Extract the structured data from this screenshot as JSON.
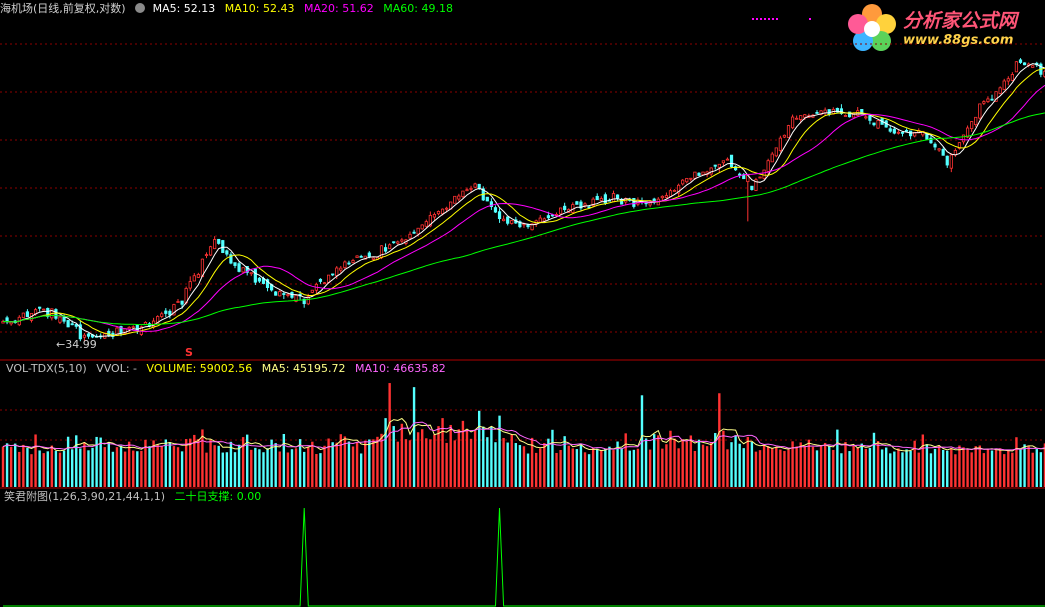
{
  "main_header": {
    "title": "海机场(日线,前复权,对数)",
    "ma5_label": "MA5: 52.13",
    "ma10_label": "MA10: 52.43",
    "ma20_label": "MA20: 51.62",
    "ma60_label": "MA60: 49.18"
  },
  "price_annotations": {
    "low_label": "←34.99",
    "signal_marker": "S"
  },
  "vol_header": {
    "title": "VOL-TDX(5,10)",
    "vvol": "VVOL: -",
    "volume": "VOLUME: 59002.56",
    "ma5": "MA5: 45195.72",
    "ma10": "MA10: 46635.82"
  },
  "ind_header": {
    "title": "笑君附图(1,26,3,90,21,44,1,1)",
    "support": "二十日支撑: 0.00"
  },
  "logo": {
    "text": "分析家公式网",
    "url": "www.88gs.com"
  },
  "colors": {
    "up": "#ff3232",
    "down": "#54ffff",
    "ma5": "#ffffff",
    "ma10": "#ffff00",
    "ma20": "#ff00ff",
    "ma60": "#00ff00",
    "grid": "#8b0000",
    "support": "#00ff00"
  },
  "chart_data": [
    {
      "type": "candlestick",
      "scale": "log",
      "ma_series": [
        {
          "name": "MA5",
          "last": 52.13
        },
        {
          "name": "MA10",
          "last": 52.43
        },
        {
          "name": "MA20",
          "last": 51.62
        },
        {
          "name": "MA60",
          "last": 49.18
        }
      ],
      "annotations": [
        {
          "text": "34.99",
          "kind": "low"
        }
      ],
      "trend_keypoints_close": [
        [
          0,
          36.2
        ],
        [
          10,
          37.4
        ],
        [
          20,
          35.2
        ],
        [
          28,
          35.6
        ],
        [
          38,
          36.5
        ],
        [
          44,
          38.0
        ],
        [
          52,
          42.8
        ],
        [
          58,
          40.4
        ],
        [
          66,
          38.7
        ],
        [
          74,
          38.0
        ],
        [
          82,
          40.6
        ],
        [
          90,
          41.6
        ],
        [
          100,
          43.3
        ],
        [
          108,
          45.8
        ],
        [
          116,
          48.0
        ],
        [
          122,
          44.6
        ],
        [
          128,
          44.2
        ],
        [
          138,
          45.5
        ],
        [
          148,
          46.6
        ],
        [
          160,
          46.2
        ],
        [
          168,
          48.5
        ],
        [
          178,
          50.1
        ],
        [
          184,
          47.6
        ],
        [
          186,
          49.0
        ],
        [
          194,
          54.7
        ],
        [
          202,
          55.5
        ],
        [
          212,
          55.0
        ],
        [
          218,
          53.5
        ],
        [
          226,
          53.3
        ],
        [
          232,
          50.0
        ],
        [
          240,
          55.8
        ],
        [
          250,
          61.3
        ],
        [
          256,
          59.9
        ]
      ]
    },
    {
      "type": "bar",
      "name": "VOLUME",
      "last": 59002.56,
      "ma5_last": 45195.72,
      "ma10_last": 46635.82
    },
    {
      "type": "line",
      "name": "二十日支撑",
      "last": 0.0,
      "spikes": [
        {
          "bar": 74,
          "value": 1
        },
        {
          "bar": 122,
          "value": 1
        }
      ]
    }
  ]
}
